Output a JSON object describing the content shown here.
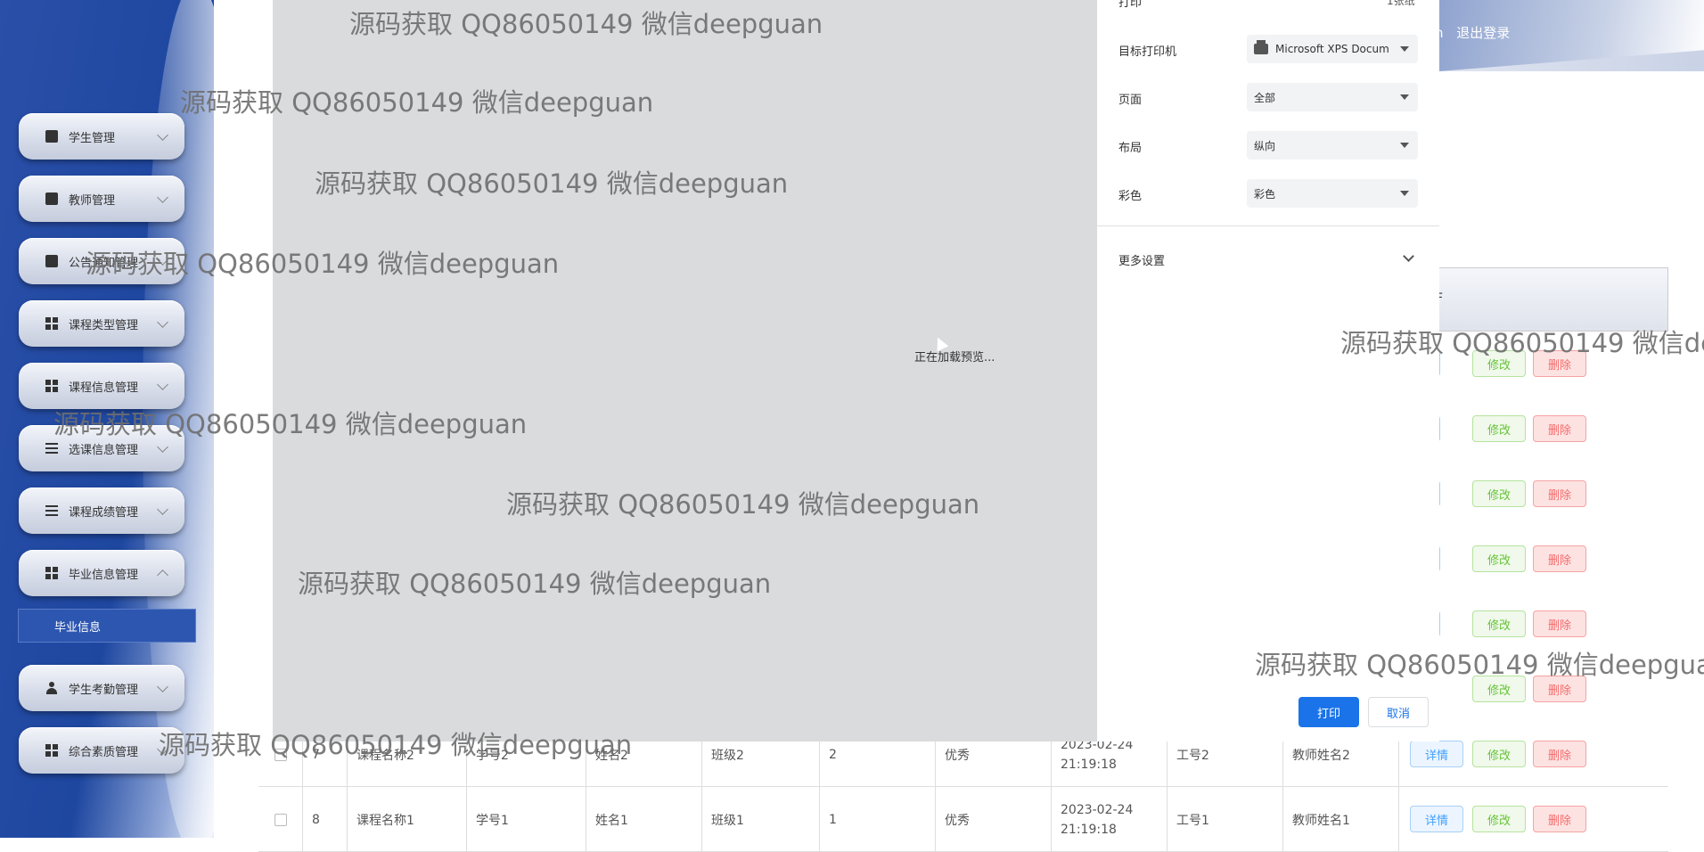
{
  "sidebar": {
    "items": [
      {
        "label": "学生管理",
        "icon": "briefcase-icon"
      },
      {
        "label": "教师管理",
        "icon": "briefcase-icon"
      },
      {
        "label": "公告通知管理",
        "icon": "clipboard-icon"
      },
      {
        "label": "课程类型管理",
        "icon": "grid-icon"
      },
      {
        "label": "课程信息管理",
        "icon": "grid-icon"
      },
      {
        "label": "选课信息管理",
        "icon": "sliders-icon"
      },
      {
        "label": "课程成绩管理",
        "icon": "list-icon"
      },
      {
        "label": "毕业信息管理",
        "icon": "grid-icon"
      },
      {
        "label": "学生考勤管理",
        "icon": "user-icon"
      },
      {
        "label": "综合素质管理",
        "icon": "grid-icon"
      }
    ],
    "subitem": "毕业信息"
  },
  "topbar": {
    "user_suffix": "n",
    "logout": "退出登录"
  },
  "table": {
    "header_partial": "F",
    "buttons": {
      "detail": "详情",
      "detail_partial": "情",
      "edit": "修改",
      "delete": "删除"
    },
    "rows": [
      {
        "index": "7",
        "course": "课程名称2",
        "student_no": "学号2",
        "name": "姓名2",
        "class": "班级2",
        "value": "2",
        "grade": "优秀",
        "time": "2023-02-24 21:19:18",
        "teacher_no": "工号2",
        "teacher": "教师姓名2"
      },
      {
        "index": "8",
        "course": "课程名称1",
        "student_no": "学号1",
        "name": "姓名1",
        "class": "班级1",
        "value": "1",
        "grade": "优秀",
        "time": "2023-02-24 21:19:18",
        "teacher_no": "工号1",
        "teacher": "教师姓名1"
      }
    ]
  },
  "print_dialog": {
    "title_partial": "打印",
    "sheets_partial": "1张纸",
    "loading": "正在加载预览...",
    "printer_label": "目标打印机",
    "printer_value": "Microsoft XPS Docum",
    "pages_label": "页面",
    "pages_value": "全部",
    "layout_label": "布局",
    "layout_value": "纵向",
    "color_label": "彩色",
    "color_value": "彩色",
    "more_settings": "更多设置",
    "print_button": "打印",
    "cancel_button": "取消",
    "accent_color": "#1a73e8"
  },
  "watermark": "源码获取 QQ86050149 微信deepguan"
}
